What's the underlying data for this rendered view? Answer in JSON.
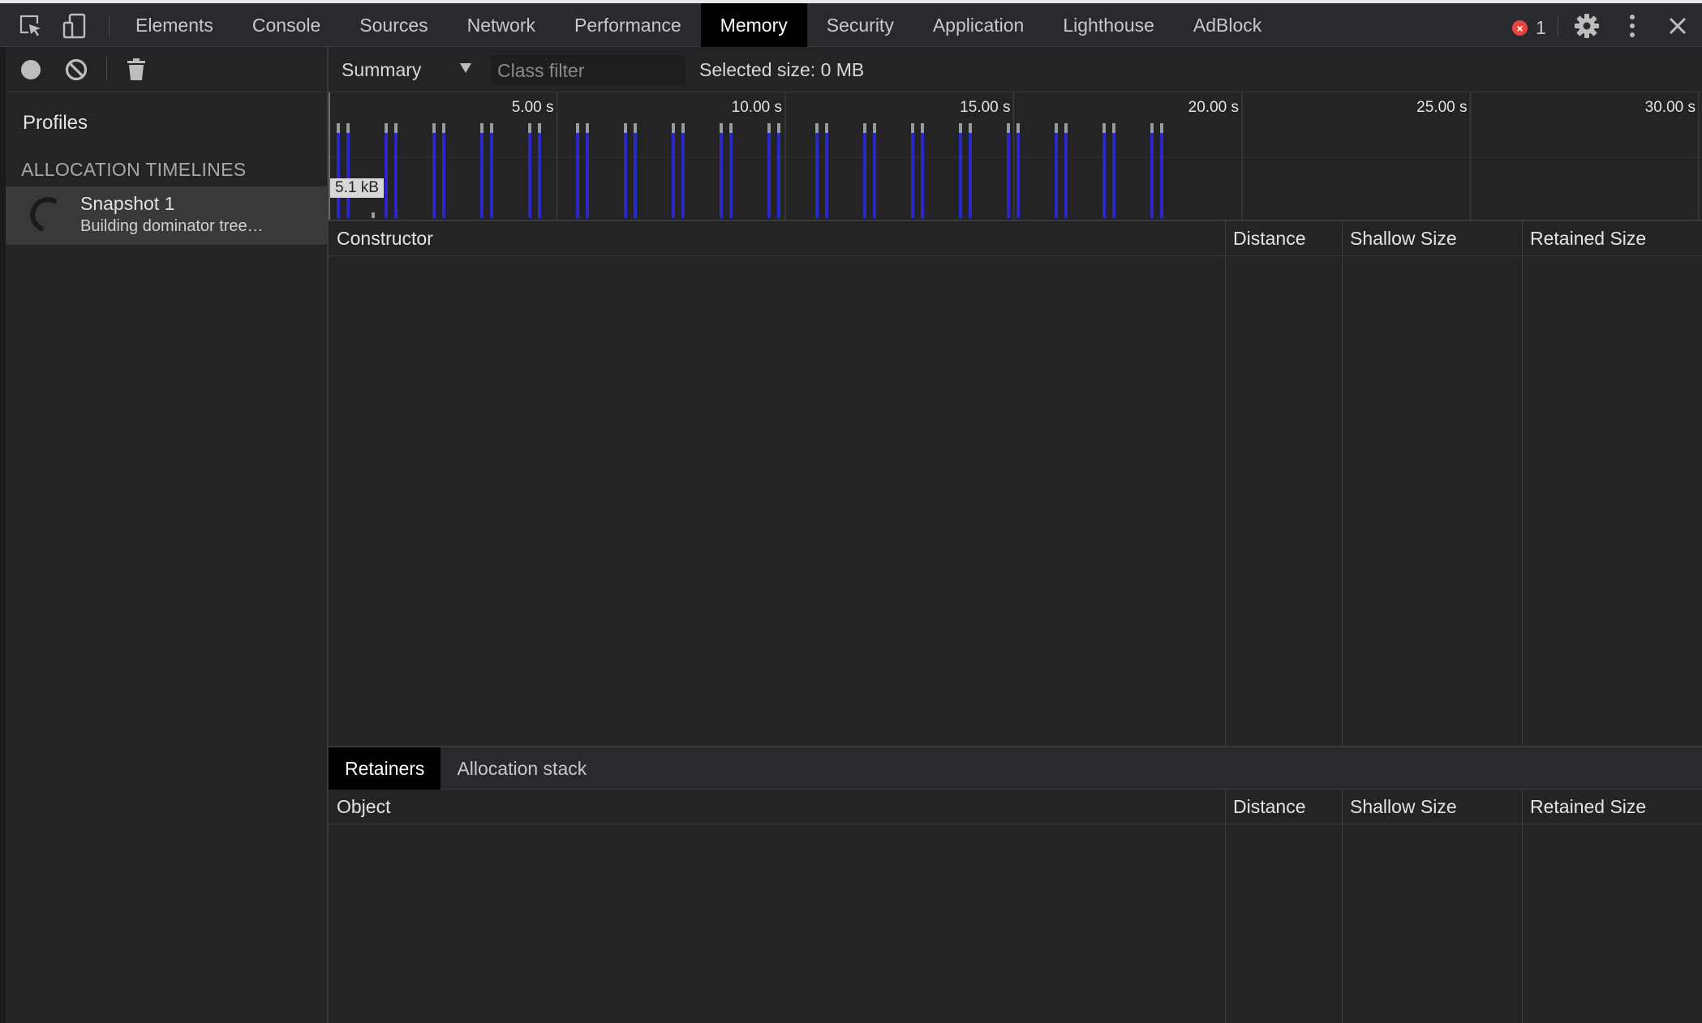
{
  "topbar": {
    "tabs": [
      {
        "label": "Elements",
        "active": false
      },
      {
        "label": "Console",
        "active": false
      },
      {
        "label": "Sources",
        "active": false
      },
      {
        "label": "Network",
        "active": false
      },
      {
        "label": "Performance",
        "active": false
      },
      {
        "label": "Memory",
        "active": true
      },
      {
        "label": "Security",
        "active": false
      },
      {
        "label": "Application",
        "active": false
      },
      {
        "label": "Lighthouse",
        "active": false
      },
      {
        "label": "AdBlock",
        "active": false
      }
    ],
    "error_count": "1",
    "icons": [
      "inspect-element-icon",
      "device-toolbar-icon",
      "error-icon",
      "gear-icon",
      "kebab-menu-icon",
      "close-icon"
    ]
  },
  "sidebar": {
    "icons": [
      "record-icon",
      "clear-icon",
      "trash-icon"
    ],
    "profiles_title": "Profiles",
    "section_title": "ALLOCATION TIMELINES",
    "snapshot": {
      "title": "Snapshot 1",
      "status": "Building dominator tree…"
    }
  },
  "toolbar": {
    "view": "Summary",
    "class_filter_placeholder": "Class filter",
    "selected_size": "Selected size: 0 MB"
  },
  "timeline": {
    "tick_labels": [
      "5.00 s",
      "10.00 s",
      "15.00 s",
      "20.00 s",
      "25.00 s",
      "30.00 s"
    ],
    "size_label": "5.1 kB",
    "colors": {
      "bar": "#2a28c8",
      "cap": "#9a9a9a",
      "grid": "#3a3a3a"
    }
  },
  "constructor_grid": {
    "columns": [
      "Constructor",
      "Distance",
      "Shallow Size",
      "Retained Size"
    ]
  },
  "bottom_tabs": [
    {
      "label": "Retainers",
      "active": true
    },
    {
      "label": "Allocation stack",
      "active": false
    }
  ],
  "retainers_grid": {
    "columns": [
      "Object",
      "Distance",
      "Shallow Size",
      "Retained Size"
    ]
  }
}
